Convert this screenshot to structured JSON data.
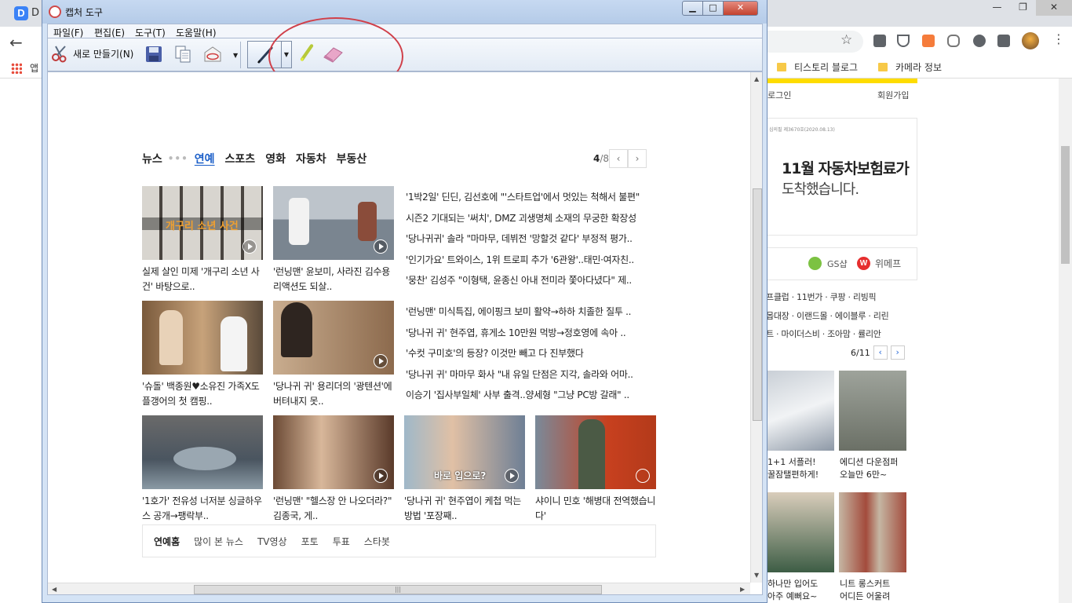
{
  "browser": {
    "tab_logo": "D",
    "tab_letter": "D",
    "apps_label": "앱",
    "bookmarks": [
      "티스토리 블로그",
      "카메라 정보"
    ],
    "daum": {
      "login": "로그인",
      "join": "회원가입",
      "ad_note": "심의필 제3670호(2020.08.13)",
      "ad_title": "11월 자동차보험료가",
      "ad_sub": "도착했습니다.",
      "shop_gs": "GS샵",
      "shop_wemef": "위메프",
      "shop_lines": [
        "프클럽 · 11번가 · 쿠팡 · 리빙픽",
        "몹대장 · 이랜드몰 · 에이블루 · 리린",
        "트 · 마이더스비 · 조아맘 · 률리안"
      ],
      "pager": "6/11",
      "products": [
        {
          "caption": "1+1 서플러!\n꿀잠탤편하게!"
        },
        {
          "caption": "에디션 다운점퍼\n오늘만 6만~"
        },
        {
          "caption": "하나만 입어도\n아주 예뻐요~"
        },
        {
          "caption": "니트 롱스커트\n어디든 어울려"
        }
      ]
    }
  },
  "snip": {
    "title": "캡처 도구",
    "menu": [
      "파일(F)",
      "편집(E)",
      "도구(T)",
      "도움말(H)"
    ],
    "new_label": "새로 만들기(N)",
    "controls": {
      "min": "▁",
      "max": "□",
      "close": "✕"
    }
  },
  "news": {
    "tabs": [
      "뉴스",
      "연예",
      "스포츠",
      "영화",
      "자동차",
      "부동산"
    ],
    "active_tab": "연예",
    "page_current": "4",
    "page_total": "/8",
    "thumbs_row1": [
      {
        "caption": "실제 살인 미제 '개구리 소년 사건' 바탕으로..",
        "overlay": "개구리 소년 사건"
      },
      {
        "caption": "'런닝맨' 윤보미, 사라진 김수용 리액션도 되살.."
      }
    ],
    "list1": [
      "'1박2일' 딘딘, 김선호에 \"'스타트업'에서 멋있는 척해서 불편\"",
      "시즌2 기대되는 '써치', DMZ 괴생명체 소재의 무궁한 확장성",
      "'당나귀귀' 솔라 \"마마무, 데뷔전 '망할것 같다' 부정적 평가..",
      "'인기가요' 트와이스, 1위 트로피 추가 '6관왕'..태민·여자친..",
      "'뭉찬' 김성주 \"이형택, 윤종신 아내 전미라 쫓아다녔다\" 제.."
    ],
    "thumbs_row2": [
      {
        "caption": "'슈돌' 백종원♥소유진 가족X도플갱어의 첫 캠핑.."
      },
      {
        "caption": "'당나귀 귀' 용리더의 '광텐션'에 버텨내지 못.."
      }
    ],
    "list2": [
      "'런닝맨' 미식특집, 에이핑크 보미 활약→하하 치졸한 질투 ..",
      "'당나귀 귀' 현주엽, 휴게소 10만원 먹방→정호영에 속아 ..",
      "'수컷 구미호'의 등장? 이것만 빼고 다 진부했다",
      "'당나귀 귀' 마마무 화사 \"내 유일 단점은 지각, 솔라와 어마..",
      "이승기 '집사부일체' 사부 출격..양세형 \"그냥 PC방 갈래\" .."
    ],
    "thumbs_row3": [
      {
        "caption": "'1호가' 전유성 너저분 싱글하우스 공개→팽락부.."
      },
      {
        "caption": "'런닝맨' \"헬스장 안 나오더라?\" 김종국, 게.."
      },
      {
        "caption": "'당나귀 귀' 현주엽이 케첩 먹는 방법 '포장째..",
        "overlay": "바로 입으로?"
      },
      {
        "caption": "샤이니 민호 '해병대 전역했습니다'"
      }
    ],
    "footer": {
      "home": "연예홈",
      "links": [
        "많이 본 뉴스",
        "TV영상",
        "포토",
        "투표",
        "스타봇"
      ]
    }
  },
  "colors": {
    "accent_blue": "#1a5ec8",
    "highlight_circle": "#d0404a",
    "daum_yellow": "#fedc00"
  }
}
